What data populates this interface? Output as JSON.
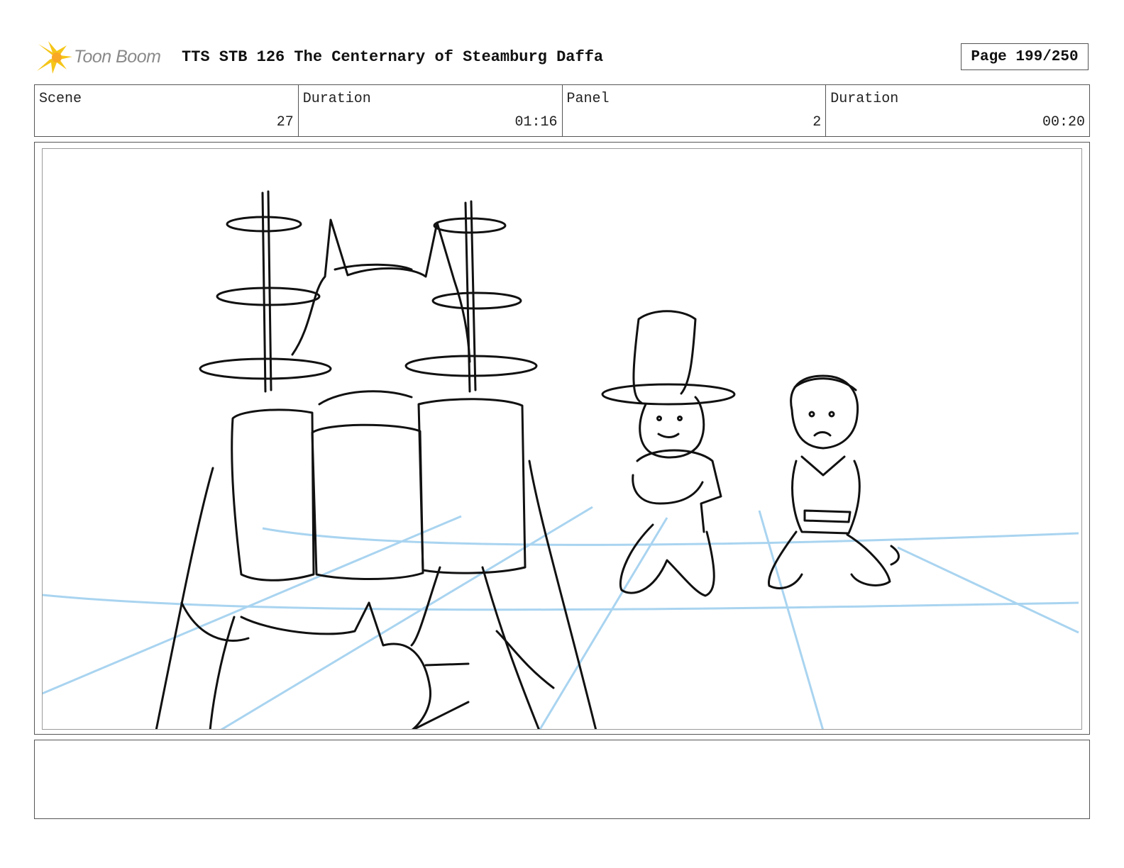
{
  "header": {
    "logo_text": "Toon Boom",
    "title": "TTS STB 126 The Centernary of Steamburg Daffa",
    "page_label": "Page 199/250"
  },
  "info": {
    "scene_label": "Scene",
    "scene_value": "27",
    "scene_duration_label": "Duration",
    "scene_duration_value": "01:16",
    "panel_label": "Panel",
    "panel_value": "2",
    "panel_duration_label": "Duration",
    "panel_duration_value": "00:20"
  },
  "colors": {
    "guide_lines": "#a9d4f0",
    "sketch": "#111111",
    "logo_star": "#f5c518"
  },
  "panel": {
    "content": "storyboard sketch"
  },
  "notes": {
    "text": ""
  }
}
